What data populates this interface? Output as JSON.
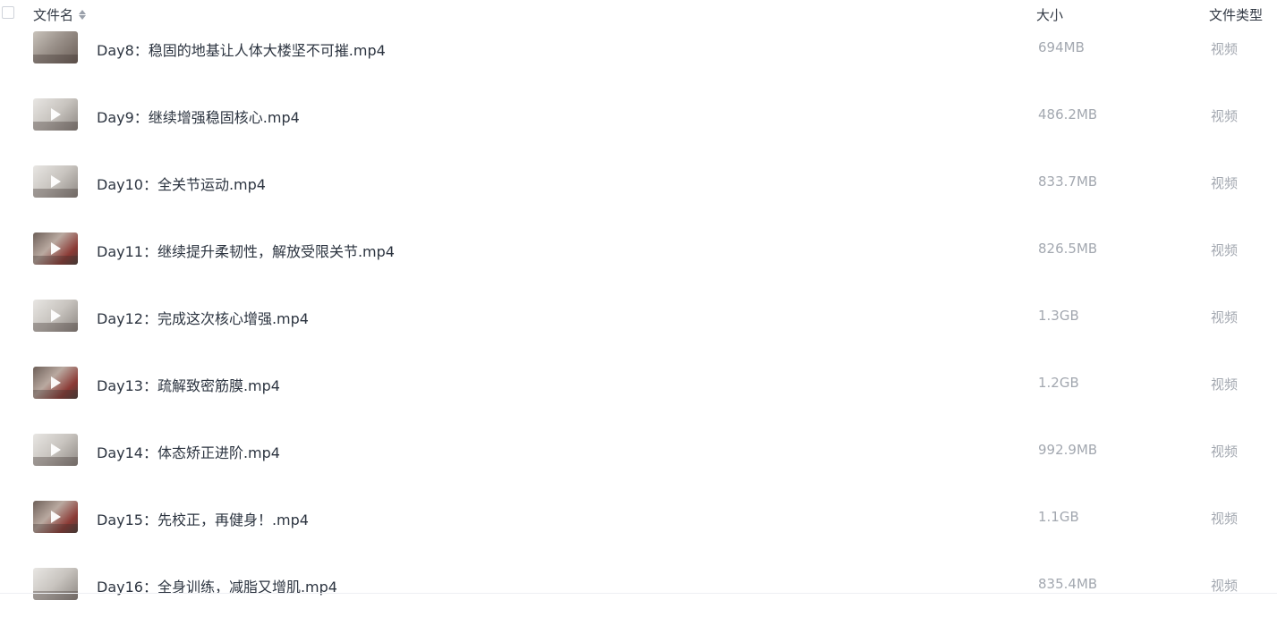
{
  "header": {
    "name_label": "文件名",
    "size_label": "大小",
    "type_label": "文件类型"
  },
  "files": [
    {
      "name": "Day8：稳固的地基让人体大楼坚不可摧.mp4",
      "size": "694MB",
      "type": "视频"
    },
    {
      "name": "Day9：继续增强稳固核心.mp4",
      "size": "486.2MB",
      "type": "视频"
    },
    {
      "name": "Day10：全关节运动.mp4",
      "size": "833.7MB",
      "type": "视频"
    },
    {
      "name": "Day11：继续提升柔韧性，解放受限关节.mp4",
      "size": "826.5MB",
      "type": "视频"
    },
    {
      "name": "Day12：完成这次核心增强.mp4",
      "size": "1.3GB",
      "type": "视频"
    },
    {
      "name": "Day13：疏解致密筋膜.mp4",
      "size": "1.2GB",
      "type": "视频"
    },
    {
      "name": "Day14：体态矫正进阶.mp4",
      "size": "992.9MB",
      "type": "视频"
    },
    {
      "name": "Day15：先校正，再健身！.mp4",
      "size": "1.1GB",
      "type": "视频"
    },
    {
      "name": "Day16：全身训练，减脂又增肌.mp4",
      "size": "835.4MB",
      "type": "视频"
    }
  ]
}
